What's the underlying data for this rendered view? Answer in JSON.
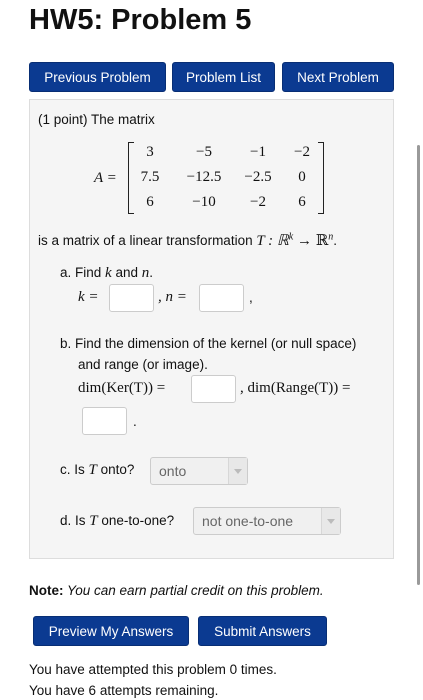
{
  "header": {
    "title": "HW5: Problem 5"
  },
  "nav": {
    "previous": "Previous Problem",
    "list": "Problem List",
    "next": "Next Problem"
  },
  "problem": {
    "intro": "(1 point) The matrix",
    "matrix_label": "A =",
    "matrix": [
      [
        "3",
        "−5",
        "−1",
        "−2"
      ],
      [
        "7.5",
        "−12.5",
        "−2.5",
        "0"
      ],
      [
        "6",
        "−10",
        "−2",
        "6"
      ]
    ],
    "statement_pre": "is a matrix of a linear transformation ",
    "statement_math": "T : ℝ",
    "sup_k": "k",
    "arrow": " → ℝ",
    "sup_n": "n",
    "period": ".",
    "part_a": {
      "label": "a. Find ",
      "k": "k",
      "and": " and ",
      "n": "n",
      "dot": ".",
      "k_eq": "k =",
      "n_eq": ", n =",
      "trail": ","
    },
    "part_b": {
      "line1": "b. Find the dimension of the kernel (or null space)",
      "line2": "and range (or image).",
      "ker": "dim(Ker(T)) =",
      "range": ", dim(Range(T)) =",
      "trail": "."
    },
    "part_c": {
      "label": "c. Is ",
      "T": "T",
      "q": " onto?",
      "value": "onto"
    },
    "part_d": {
      "label": "d. Is ",
      "T": "T",
      "q": " one-to-one?",
      "value": "not one-to-one"
    }
  },
  "note": {
    "bold": "Note:",
    "text": " You can earn partial credit on this problem."
  },
  "actions": {
    "preview": "Preview My Answers",
    "submit": "Submit Answers"
  },
  "status": {
    "attempted": "You have attempted this problem 0 times.",
    "remaining": "You have 6 attempts remaining."
  }
}
